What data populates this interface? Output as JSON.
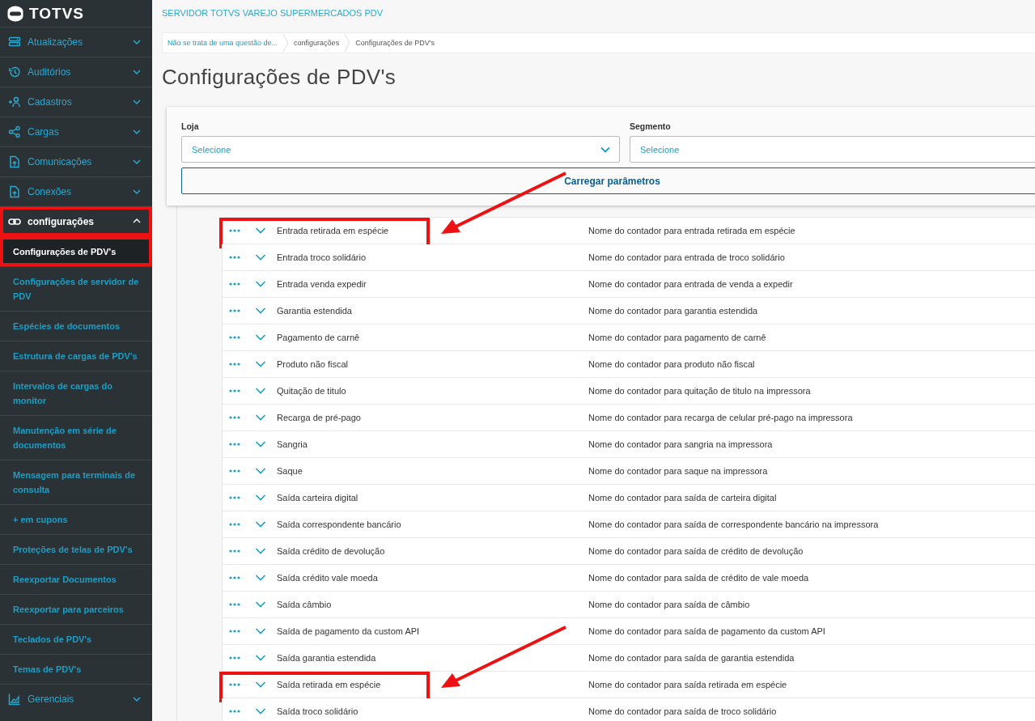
{
  "sidebar": {
    "logo": "TOTVS",
    "groups": [
      {
        "label": "Atualizações",
        "expanded": false,
        "highlighted": false
      },
      {
        "label": "Auditórios",
        "expanded": false,
        "highlighted": false
      },
      {
        "label": "Cadastros",
        "expanded": false,
        "highlighted": false
      },
      {
        "label": "Cargas",
        "expanded": false,
        "highlighted": false
      },
      {
        "label": "Comunicações",
        "expanded": false,
        "highlighted": false
      },
      {
        "label": "Conexões",
        "expanded": false,
        "highlighted": false
      },
      {
        "label": "configurações",
        "expanded": true,
        "highlighted": true,
        "children": [
          {
            "label": "Configurações de PDV's",
            "selected": true,
            "highlighted": true
          },
          {
            "label": "Configurações de servidor de PDV",
            "selected": false,
            "highlighted": false
          },
          {
            "label": "Espécies de documentos",
            "selected": false,
            "highlighted": false
          },
          {
            "label": "Estrutura de cargas de PDV's",
            "selected": false,
            "highlighted": false
          },
          {
            "label": "Intervalos de cargas do monitor",
            "selected": false,
            "highlighted": false
          },
          {
            "label": "Manutenção em série de documentos",
            "selected": false,
            "highlighted": false
          },
          {
            "label": "Mensagem para terminais de consulta",
            "selected": false,
            "highlighted": false
          },
          {
            "label": "+ em cupons",
            "selected": false,
            "highlighted": false
          },
          {
            "label": "Proteções de telas de PDV's",
            "selected": false,
            "highlighted": false
          },
          {
            "label": "Reexportar Documentos",
            "selected": false,
            "highlighted": false
          },
          {
            "label": "Reexportar para parceiros",
            "selected": false,
            "highlighted": false
          },
          {
            "label": "Teclados de PDV's",
            "selected": false,
            "highlighted": false
          },
          {
            "label": "Temas de PDV's",
            "selected": false,
            "highlighted": false
          }
        ]
      },
      {
        "label": "Gerenciais",
        "expanded": false,
        "highlighted": false
      }
    ]
  },
  "header": {
    "app_title": "SERVIDOR TOTVS VAREJO SUPERMERCADOS PDV"
  },
  "breadcrumb": [
    "Não se trata de uma questão de...",
    "configurações",
    "Configurações de PDV's"
  ],
  "page_title": "Configurações de PDV's",
  "filters": [
    {
      "label": "Loja",
      "placeholder": "Selecione"
    },
    {
      "label": "Segmento",
      "placeholder": "Selecione"
    }
  ],
  "load_button": "Carregar parâmetros",
  "rows": [
    {
      "name": "Entrada retirada em espécie",
      "description": "Nome do contador para entrada retirada em espécie",
      "highlighted": true
    },
    {
      "name": "Entrada troco solidário",
      "description": "Nome do contador para entrada de troco solidário",
      "highlighted": false
    },
    {
      "name": "Entrada venda expedir",
      "description": "Nome do contador para entrada de venda a expedir",
      "highlighted": false
    },
    {
      "name": "Garantia estendida",
      "description": "Nome do contador para garantia estendida",
      "highlighted": false
    },
    {
      "name": "Pagamento de carnê",
      "description": "Nome do contador para pagamento de carnê",
      "highlighted": false
    },
    {
      "name": "Produto não fiscal",
      "description": "Nome do contador para produto não fiscal",
      "highlighted": false
    },
    {
      "name": "Quitação de titulo",
      "description": "Nome do contador para quitação de titulo na impressora",
      "highlighted": false
    },
    {
      "name": "Recarga de pré-pago",
      "description": "Nome do contador para recarga de celular pré-pago na impressora",
      "highlighted": false
    },
    {
      "name": "Sangria",
      "description": "Nome do contador para sangria na impressora",
      "highlighted": false
    },
    {
      "name": "Saque",
      "description": "Nome do contador para saque na impressora",
      "highlighted": false
    },
    {
      "name": "Saída carteira digital",
      "description": "Nome do contador para saída de carteira digital",
      "highlighted": false
    },
    {
      "name": "Saída correspondente bancário",
      "description": "Nome do contador para saída de correspondente bancário na impressora",
      "highlighted": false
    },
    {
      "name": "Saída crédito de devolução",
      "description": "Nome do contador para saída de crédito de devolução",
      "highlighted": false
    },
    {
      "name": "Saída crédito vale moeda",
      "description": "Nome do contador para saída de crédito de vale moeda",
      "highlighted": false
    },
    {
      "name": "Saída câmbio",
      "description": "Nome do contador para saída de câmbio",
      "highlighted": false
    },
    {
      "name": "Saída de pagamento da custom API",
      "description": "Nome do contador para saída de pagamento da custom API",
      "highlighted": false
    },
    {
      "name": "Saída garantia estendida",
      "description": "Nome do contador para saída de garantia estendida",
      "highlighted": false
    },
    {
      "name": "Saída retirada em espécie",
      "description": "Nome do contador para saída retirada em espécie",
      "highlighted": true
    },
    {
      "name": "Saída troco solidário",
      "description": "Nome do contador para saída de troco solidário",
      "highlighted": false
    }
  ]
}
